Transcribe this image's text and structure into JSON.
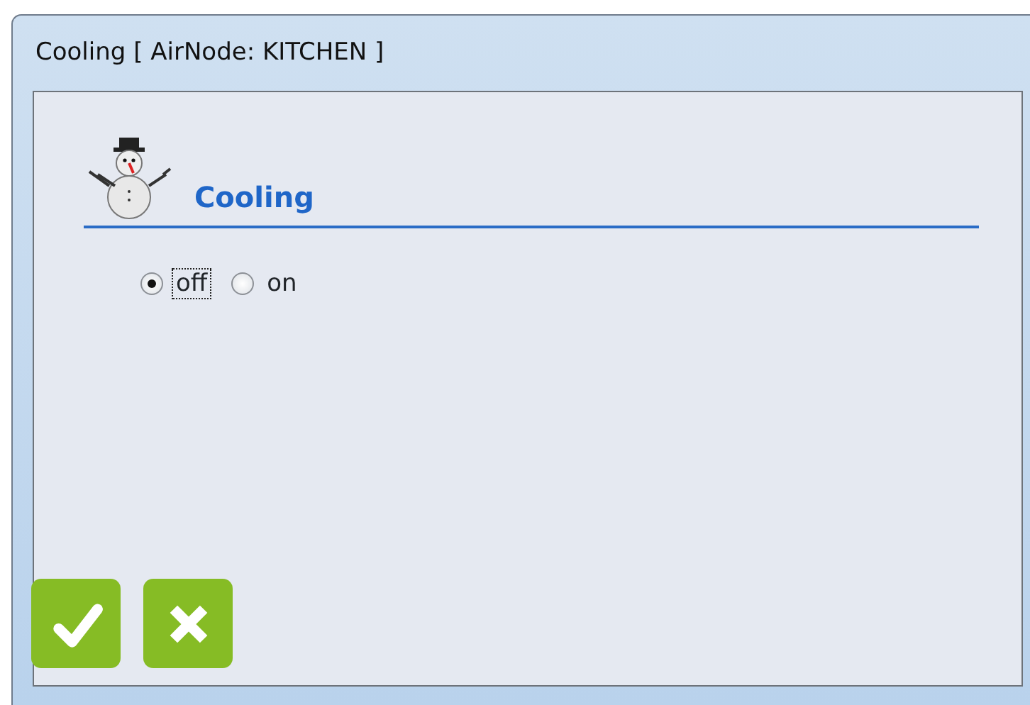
{
  "window": {
    "title": "Cooling [ AirNode: KITCHEN ]"
  },
  "section": {
    "heading": "Cooling"
  },
  "options": [
    {
      "label": "off",
      "selected": true,
      "focused": true
    },
    {
      "label": "on",
      "selected": false,
      "focused": false
    }
  ],
  "buttons": [
    {
      "kind": "ok"
    },
    {
      "kind": "cancel"
    }
  ]
}
